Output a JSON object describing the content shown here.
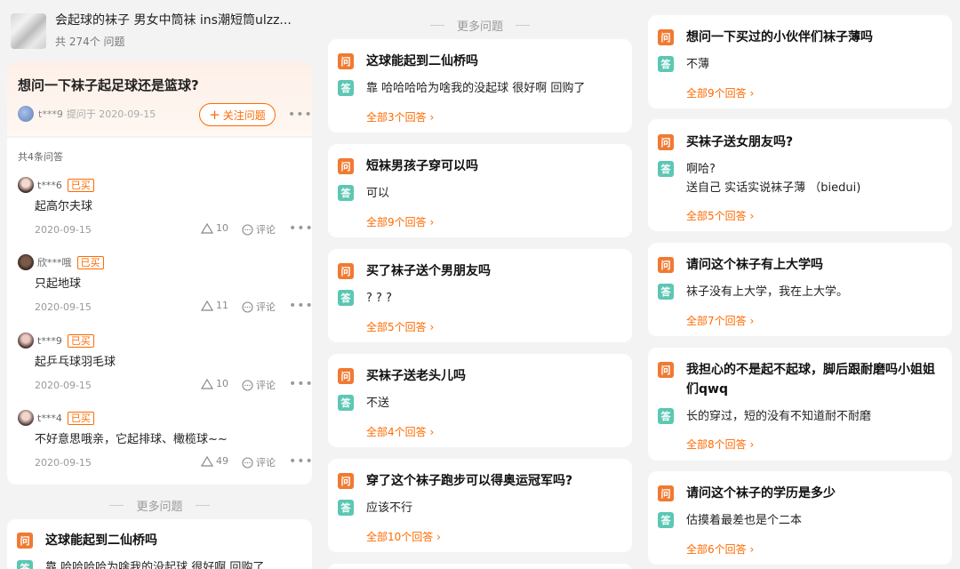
{
  "product": {
    "title": "会起球的袜子 男女中筒袜 ins潮短筒ulzz...",
    "count": "共 274个 问题"
  },
  "question": {
    "title": "想问一下袜子起足球还是篮球?",
    "user": "t***9",
    "date": "提问于 2020-09-15",
    "follow_label": "关注问题",
    "answer_count": "共4条问答"
  },
  "answers": [
    {
      "user": "t***6",
      "badge": "已买",
      "text": "起高尔夫球",
      "date": "2020-09-15",
      "likes": "10",
      "comment": "评论"
    },
    {
      "user": "欣***哦",
      "badge": "已买",
      "text": "只起地球",
      "date": "2020-09-15",
      "likes": "11",
      "comment": "评论"
    },
    {
      "user": "t***9",
      "badge": "已买",
      "text": "起乒乓球羽毛球",
      "date": "2020-09-15",
      "likes": "10",
      "comment": "评论"
    },
    {
      "user": "t***4",
      "badge": "已买",
      "text": "不好意思哦亲，它起排球、橄榄球~~",
      "date": "2020-09-15",
      "likes": "49",
      "comment": "评论"
    }
  ],
  "more_label": "更多问题",
  "tags": {
    "q": "问",
    "a": "答"
  },
  "col1_partial": {
    "q": "这球能起到二仙桥吗",
    "a": "靠 哈哈哈哈为啥我的没起球 很好啊 回购了"
  },
  "col2": [
    {
      "q": "这球能起到二仙桥吗",
      "a": [
        "靠 哈哈哈哈为啥我的没起球  很好啊 回购了"
      ],
      "all": "全部3个回答"
    },
    {
      "q": "短袜男孩子穿可以吗",
      "a": [
        "可以"
      ],
      "all": "全部9个回答"
    },
    {
      "q": "买了袜子送个男朋友吗",
      "a": [
        "? ? ?"
      ],
      "all": "全部5个回答"
    },
    {
      "q": "买袜子送老头儿吗",
      "a": [
        "不送"
      ],
      "all": "全部4个回答"
    },
    {
      "q": "穿了这个袜子跑步可以得奥运冠军吗?",
      "a": [
        "应该不行"
      ],
      "all": "全部10个回答"
    }
  ],
  "col3": [
    {
      "q": "想问一下买过的小伙伴们袜子薄吗",
      "a": [
        "不薄"
      ],
      "all": "全部9个回答"
    },
    {
      "q": "买袜子送女朋友吗?",
      "a": [
        "啊哈?",
        "送自己 实话实说袜子薄 （biedui)"
      ],
      "all": "全部5个回答"
    },
    {
      "q": "请问这个袜子有上大学吗",
      "a": [
        "袜子没有上大学，我在上大学。"
      ],
      "all": "全部7个回答"
    },
    {
      "q": "我担心的不是起不起球，脚后跟耐磨吗小姐姐们qwq",
      "a": [
        "长的穿过，短的没有不知道耐不耐磨"
      ],
      "all": "全部8个回答"
    },
    {
      "q": "请问这个袜子的学历是多少",
      "a": [
        "估摸着最差也是个二本"
      ],
      "all": "全部6个回答"
    }
  ],
  "colors": {
    "accent": "#ff6a00",
    "q_tag": "#f07a32",
    "a_tag": "#5cc7b4"
  }
}
